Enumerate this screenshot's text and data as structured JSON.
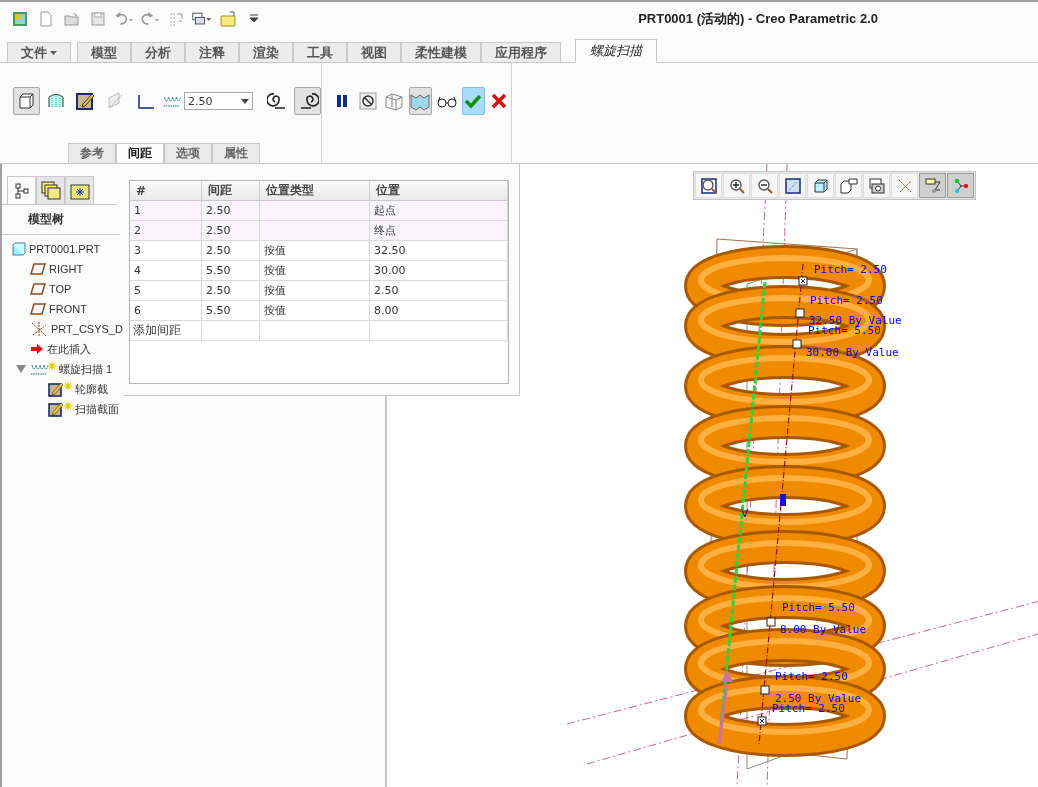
{
  "window": {
    "title": "PRT0001 (活动的) - Creo Parametric 2.0"
  },
  "quick_access": [
    {
      "kind": "app"
    },
    {
      "kind": "new"
    },
    {
      "kind": "open"
    },
    {
      "kind": "save"
    },
    {
      "kind": "undo"
    },
    {
      "kind": "redo"
    },
    {
      "kind": "regenerate"
    },
    {
      "kind": "windows"
    },
    {
      "kind": "close"
    },
    {
      "kind": "customize"
    }
  ],
  "ribbon_tabs": [
    {
      "label": "文件",
      "selected": false,
      "kind": "menu"
    },
    {
      "label": "模型",
      "selected": false,
      "kind": "tab"
    },
    {
      "label": "分析",
      "selected": false,
      "kind": "tab"
    },
    {
      "label": "注释",
      "selected": false,
      "kind": "tab"
    },
    {
      "label": "渲染",
      "selected": false,
      "kind": "tab"
    },
    {
      "label": "工具",
      "selected": false,
      "kind": "tab"
    },
    {
      "label": "视图",
      "selected": false,
      "kind": "tab"
    },
    {
      "label": "柔性建模",
      "selected": false,
      "kind": "tab"
    },
    {
      "label": "应用程序",
      "selected": false,
      "kind": "tab"
    },
    {
      "label": "螺旋扫描",
      "selected": true,
      "kind": "tab"
    }
  ],
  "feature_tools": [
    {
      "kind": "solid",
      "pressed": true
    },
    {
      "kind": "surface",
      "pressed": false
    },
    {
      "kind": "sketch",
      "pressed": false
    },
    {
      "kind": "remove",
      "pressed": false
    },
    {
      "kind": "thicken",
      "pressed": false
    }
  ],
  "pitch_field": {
    "value": "2.50"
  },
  "handedness": [
    {
      "kind": "left",
      "pressed": false
    },
    {
      "kind": "right",
      "pressed": true
    }
  ],
  "control_tools": [
    {
      "kind": "pause",
      "pressed": false
    },
    {
      "kind": "stop",
      "pressed": false
    },
    {
      "kind": "preview",
      "pressed": false
    },
    {
      "kind": "verify",
      "pressed": true
    },
    {
      "kind": "glasses",
      "pressed": false
    },
    {
      "kind": "ok",
      "pressed": true
    },
    {
      "kind": "cancel",
      "pressed": false
    }
  ],
  "sub_tabs": [
    {
      "label": "参考",
      "selected": false
    },
    {
      "label": "间距",
      "selected": true
    },
    {
      "label": "选项",
      "selected": false
    },
    {
      "label": "属性",
      "selected": false
    }
  ],
  "panel_tabs": [
    {
      "kind": "tree",
      "selected": true
    },
    {
      "kind": "folder",
      "selected": false
    },
    {
      "kind": "favorites",
      "selected": false
    }
  ],
  "model_tree": {
    "title": "模型树",
    "items": [
      {
        "label": "PRT0001.PRT",
        "kind": "part",
        "modified": false,
        "children": [
          {
            "label": "RIGHT",
            "kind": "plane",
            "modified": false
          },
          {
            "label": "TOP",
            "kind": "plane",
            "modified": false
          },
          {
            "label": "FRONT",
            "kind": "plane",
            "modified": false
          },
          {
            "label": "PRT_CSYS_D",
            "kind": "csys",
            "modified": false
          },
          {
            "label": "在此插入",
            "kind": "insert",
            "modified": false
          },
          {
            "label": "螺旋扫描 1",
            "kind": "helix",
            "modified": true,
            "expanded": true,
            "children": [
              {
                "label": "轮廓截",
                "kind": "sketch",
                "modified": true
              },
              {
                "label": "扫描截面",
                "kind": "sketch",
                "modified": true
              }
            ]
          }
        ]
      }
    ]
  },
  "spacing_table": {
    "columns": [
      "#",
      "间距",
      "位置类型",
      "位置"
    ],
    "rows": [
      [
        "1",
        "2.50",
        "",
        "起点"
      ],
      [
        "2",
        "2.50",
        "",
        "终点"
      ],
      [
        "3",
        "2.50",
        "按值",
        "32.50"
      ],
      [
        "4",
        "5.50",
        "按值",
        "30.00"
      ],
      [
        "5",
        "2.50",
        "按值",
        "2.50"
      ],
      [
        "6",
        "5.50",
        "按值",
        "8.00"
      ]
    ],
    "add_row": "添加间距"
  },
  "view_tools": [
    {
      "kind": "refit",
      "pressed": false
    },
    {
      "kind": "zoom-in",
      "pressed": false
    },
    {
      "kind": "zoom-out",
      "pressed": false
    },
    {
      "kind": "repaint",
      "pressed": false
    },
    {
      "kind": "display-style",
      "pressed": false
    },
    {
      "kind": "saved-views",
      "pressed": false
    },
    {
      "kind": "view-manager",
      "pressed": false
    },
    {
      "kind": "datum-display",
      "pressed": false
    },
    {
      "kind": "annotation-display",
      "pressed": true
    },
    {
      "kind": "spin-center",
      "pressed": true
    }
  ],
  "annotations": [
    "Pitch= 2.50",
    "Pitch= 2.50",
    "32.50 By Value",
    "Pitch= 5.50",
    "30.00 By Value",
    "Pitch= 5.50",
    "8.00 By Value",
    "Pitch= 2.50",
    "2.50 By Value",
    "Pitch= 2.50"
  ],
  "axis_label": "V"
}
